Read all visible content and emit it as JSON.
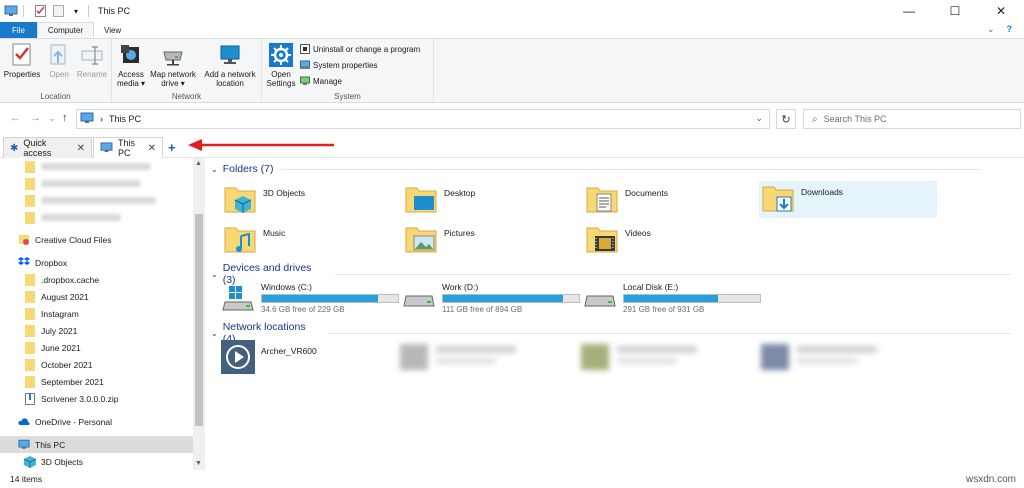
{
  "window": {
    "title": "This PC",
    "controls": {
      "minimize": "—",
      "maximize": "☐",
      "close": "✕"
    }
  },
  "ribbon_tabs": [
    {
      "label": "File"
    },
    {
      "label": "Computer"
    },
    {
      "label": "View"
    }
  ],
  "ribbon_right": {
    "expand": "⌄",
    "help": "?"
  },
  "ribbon": {
    "location": {
      "label": "Location",
      "buttons": [
        {
          "label": "Properties",
          "icon": "properties-icon"
        },
        {
          "label": "Open",
          "icon": "open-icon"
        },
        {
          "label": "Rename",
          "icon": "rename-icon"
        }
      ]
    },
    "network": {
      "label": "Network",
      "buttons": [
        {
          "label_line1": "Access",
          "label_line2": "media ▾",
          "icon": "access-media-icon"
        },
        {
          "label_line1": "Map network",
          "label_line2": "drive ▾",
          "icon": "map-network-drive-icon"
        },
        {
          "label_line1": "Add a network",
          "label_line2": "location",
          "icon": "add-network-location-icon"
        }
      ]
    },
    "system": {
      "label": "System",
      "open_settings_line1": "Open",
      "open_settings_line2": "Settings",
      "small": [
        {
          "label": "Uninstall or change a program",
          "icon": "uninstall-icon"
        },
        {
          "label": "System properties",
          "icon": "system-properties-icon"
        },
        {
          "label": "Manage",
          "icon": "manage-icon"
        }
      ]
    }
  },
  "address": {
    "back": "←",
    "forward": "→",
    "recent": "⌄",
    "up": "↑",
    "separator": "›",
    "crumb": "This PC",
    "dropdown": "⌄",
    "refresh": "↻",
    "search_placeholder": "Search This PC"
  },
  "tabs": [
    {
      "label": "Quick access",
      "close": "✕"
    },
    {
      "label": "This PC",
      "close": "✕"
    }
  ],
  "new_tab": "+",
  "navpane": {
    "items": [
      {
        "label": "Creative Cloud Files",
        "icon": "creative-cloud-icon"
      },
      {
        "label": "Dropbox",
        "icon": "dropbox-icon"
      },
      {
        "label": ".dropbox.cache",
        "icon": "folder-icon"
      },
      {
        "label": "August 2021",
        "icon": "folder-icon"
      },
      {
        "label": "Instagram",
        "icon": "folder-icon"
      },
      {
        "label": "July 2021",
        "icon": "folder-icon"
      },
      {
        "label": "June 2021",
        "icon": "folder-icon"
      },
      {
        "label": "October 2021",
        "icon": "folder-icon"
      },
      {
        "label": "September 2021",
        "icon": "folder-icon"
      },
      {
        "label": "Scrivener 3.0.0.0.zip",
        "icon": "zip-icon"
      },
      {
        "label": "OneDrive - Personal",
        "icon": "onedrive-icon"
      },
      {
        "label": "This PC",
        "icon": "this-pc-icon"
      },
      {
        "label": "3D Objects",
        "icon": "3d-objects-icon"
      }
    ]
  },
  "content": {
    "folders_header": "Folders (7)",
    "folders": [
      {
        "name": "3D Objects",
        "icon": "3d-objects-folder-icon"
      },
      {
        "name": "Desktop",
        "icon": "desktop-folder-icon"
      },
      {
        "name": "Documents",
        "icon": "documents-folder-icon"
      },
      {
        "name": "Downloads",
        "icon": "downloads-folder-icon"
      },
      {
        "name": "Music",
        "icon": "music-folder-icon"
      },
      {
        "name": "Pictures",
        "icon": "pictures-folder-icon"
      },
      {
        "name": "Videos",
        "icon": "videos-folder-icon"
      }
    ],
    "drives_header": "Devices and drives (3)",
    "drives": [
      {
        "name": "Windows (C:)",
        "free": "34.6 GB free of 229 GB",
        "used_fraction": 0.85
      },
      {
        "name": "Work (D:)",
        "free": "111 GB free of 894 GB",
        "used_fraction": 0.88
      },
      {
        "name": "Local Disk (E:)",
        "free": "291 GB free of 931 GB",
        "used_fraction": 0.69
      }
    ],
    "network_header": "Network locations (4)",
    "network": [
      {
        "name": "Archer_VR600",
        "icon": "media-server-icon"
      }
    ]
  },
  "status": {
    "count": "14 items"
  },
  "watermark": "wsxdn.com",
  "colors": {
    "accent": "#1979ca",
    "drive_fill": "#26a0da",
    "header_text": "#1e3287",
    "annotation_arrow": "#e02020"
  }
}
